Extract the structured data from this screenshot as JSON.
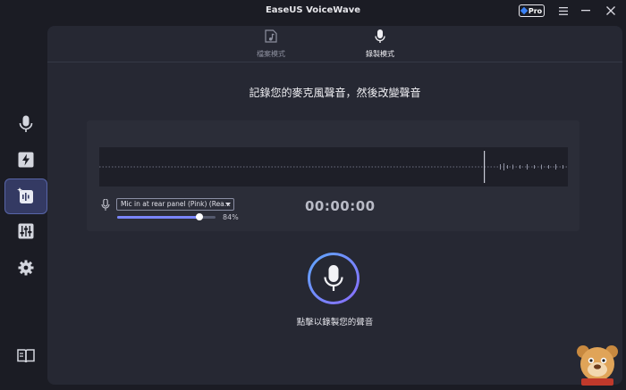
{
  "app": {
    "title": "EaseUS VoiceWave",
    "pro_label": "Pro"
  },
  "mode_tabs": [
    {
      "label": "檔案模式",
      "icon": "music-file-icon",
      "active": false
    },
    {
      "label": "錄製模式",
      "icon": "microphone-icon",
      "active": true
    }
  ],
  "sidebar": {
    "items": [
      {
        "icon": "microphone-icon",
        "active": false
      },
      {
        "icon": "lightning-icon",
        "active": false
      },
      {
        "icon": "voice-record-icon",
        "active": true
      },
      {
        "icon": "mixer-icon",
        "active": false
      },
      {
        "icon": "gear-icon",
        "active": false
      }
    ],
    "bottom_icon": "book-icon"
  },
  "main": {
    "headline": "記錄您的麥克風聲音，然後改變聲音",
    "device": {
      "selected": "Mic in at rear panel (Pink) (Rea...",
      "volume_percent": "84%",
      "volume_value": 84
    },
    "timer": "00:00:00",
    "record_hint": "點擊以錄製您的聲音"
  },
  "colors": {
    "accent": "#7a86ff",
    "background": "#1b1c24",
    "panel": "#262833"
  }
}
